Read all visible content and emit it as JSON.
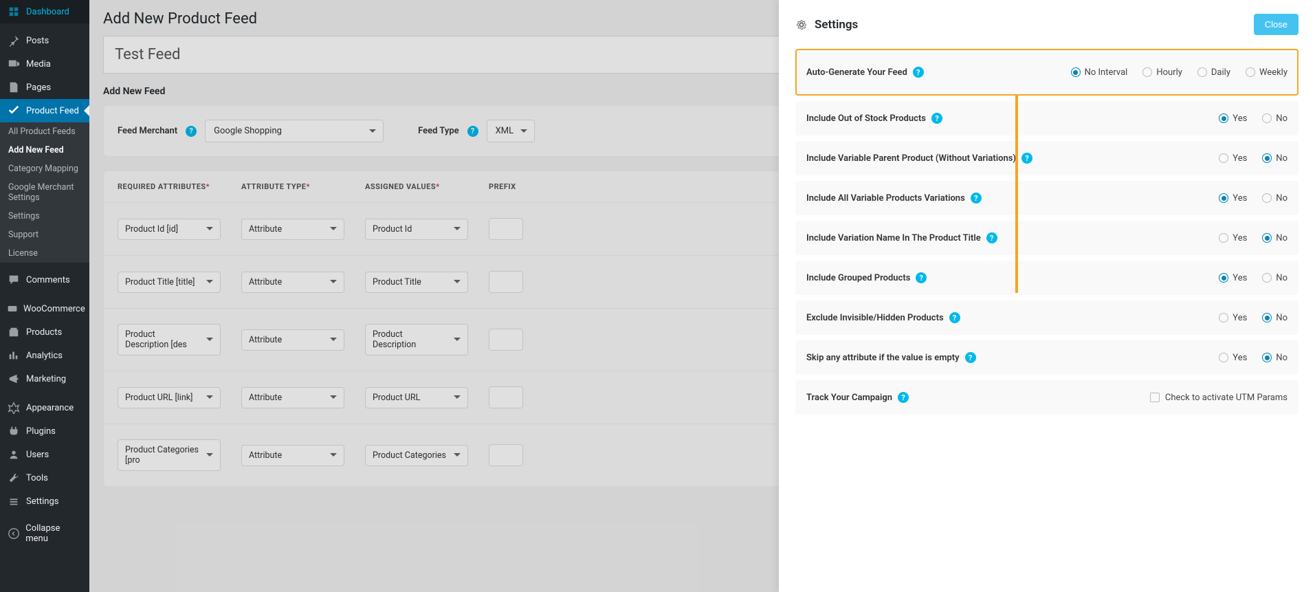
{
  "sidebar": {
    "items": [
      {
        "label": "Dashboard",
        "icon": "dashboard"
      },
      {
        "label": "Posts",
        "icon": "pin"
      },
      {
        "label": "Media",
        "icon": "media"
      },
      {
        "label": "Pages",
        "icon": "page"
      },
      {
        "label": "Product Feed",
        "icon": "feed",
        "active": true
      },
      {
        "label": "Comments",
        "icon": "comment"
      },
      {
        "label": "WooCommerce",
        "icon": "woo"
      },
      {
        "label": "Products",
        "icon": "products"
      },
      {
        "label": "Analytics",
        "icon": "analytics"
      },
      {
        "label": "Marketing",
        "icon": "marketing"
      },
      {
        "label": "Appearance",
        "icon": "appearance"
      },
      {
        "label": "Plugins",
        "icon": "plugins"
      },
      {
        "label": "Users",
        "icon": "users"
      },
      {
        "label": "Tools",
        "icon": "tools"
      },
      {
        "label": "Settings",
        "icon": "settings"
      },
      {
        "label": "Collapse menu",
        "icon": "collapse"
      }
    ],
    "submenu": [
      {
        "label": "All Product Feeds"
      },
      {
        "label": "Add New Feed",
        "active": true
      },
      {
        "label": "Category Mapping"
      },
      {
        "label": "Google Merchant Settings"
      },
      {
        "label": "Settings"
      },
      {
        "label": "Support"
      },
      {
        "label": "License"
      }
    ]
  },
  "main": {
    "page_title": "Add New Product Feed",
    "feed_title": "Test Feed",
    "section_title": "Add New Feed",
    "config": {
      "merchant_label": "Feed Merchant",
      "merchant_value": "Google Shopping",
      "type_label": "Feed Type",
      "type_value": "XML"
    },
    "table": {
      "headers": {
        "required": "Required Attributes",
        "type": "Attribute Type",
        "assigned": "Assigned Values",
        "prefix": "Prefix"
      },
      "rows": [
        {
          "req": "Product Id [id]",
          "type": "Attribute",
          "assigned": "Product Id"
        },
        {
          "req": "Product Title [title]",
          "type": "Attribute",
          "assigned": "Product Title"
        },
        {
          "req": "Product Description [des",
          "type": "Attribute",
          "assigned": "Product Description"
        },
        {
          "req": "Product URL [link]",
          "type": "Attribute",
          "assigned": "Product URL"
        },
        {
          "req": "Product Categories [pro",
          "type": "Attribute",
          "assigned": "Product Categories"
        }
      ]
    }
  },
  "settings": {
    "title": "Settings",
    "close_label": "Close",
    "rows": [
      {
        "label": "Auto-Generate Your Feed",
        "options": [
          "No Interval",
          "Hourly",
          "Daily",
          "Weekly"
        ],
        "selected": 0,
        "highlighted": true
      },
      {
        "label": "Include Out of Stock Products",
        "options": [
          "Yes",
          "No"
        ],
        "selected": 0
      },
      {
        "label": "Include Variable Parent Product (Without Variations)",
        "options": [
          "Yes",
          "No"
        ],
        "selected": 1
      },
      {
        "label": "Include All Variable Products Variations",
        "options": [
          "Yes",
          "No"
        ],
        "selected": 0
      },
      {
        "label": "Include Variation Name In The Product Title",
        "options": [
          "Yes",
          "No"
        ],
        "selected": 1
      },
      {
        "label": "Include Grouped Products",
        "options": [
          "Yes",
          "No"
        ],
        "selected": 0
      },
      {
        "label": "Exclude Invisible/Hidden Products",
        "options": [
          "Yes",
          "No"
        ],
        "selected": 1
      },
      {
        "label": "Skip any attribute if the value is empty",
        "options": [
          "Yes",
          "No"
        ],
        "selected": 1
      }
    ],
    "track": {
      "label": "Track Your Campaign",
      "checkbox_label": "Check to activate UTM Params"
    }
  }
}
